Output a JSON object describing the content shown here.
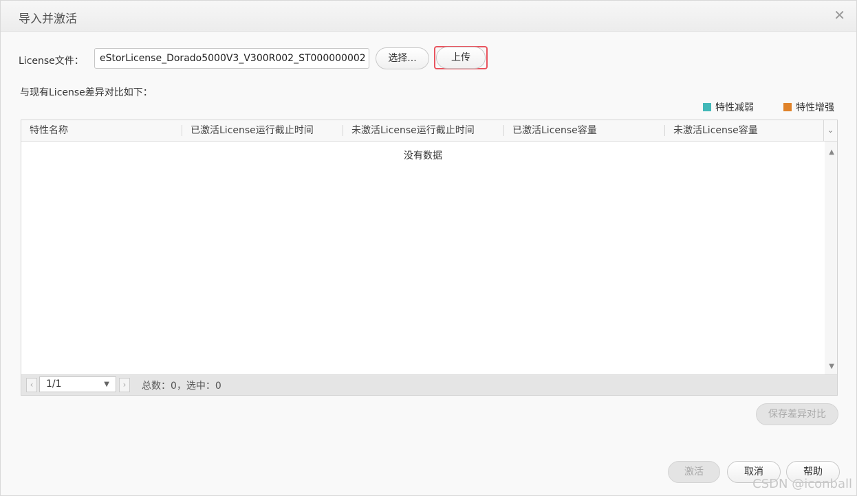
{
  "dialog": {
    "title": "导入并激活"
  },
  "license": {
    "label": "License文件：",
    "value": "eStorLicense_Dorado5000V3_V300R002_ST000000002",
    "select_label": "选择...",
    "upload_label": "上传"
  },
  "diff": {
    "label": "与现有License差异对比如下："
  },
  "legend": [
    {
      "label": "特性减弱",
      "color": "#41b8b8"
    },
    {
      "label": "特性增强",
      "color": "#e0832a"
    }
  ],
  "grid": {
    "columns": [
      "特性名称",
      "已激活License运行截止时间",
      "未激活License运行截止时间",
      "已激活License容量",
      "未激活License容量"
    ],
    "empty_text": "没有数据"
  },
  "pager": {
    "page": "1/1",
    "stats": "总数：0，选中：0"
  },
  "buttons": {
    "save_diff": "保存差异对比",
    "activate": "激活",
    "cancel": "取消",
    "help": "帮助"
  },
  "watermark": "CSDN @iconball"
}
